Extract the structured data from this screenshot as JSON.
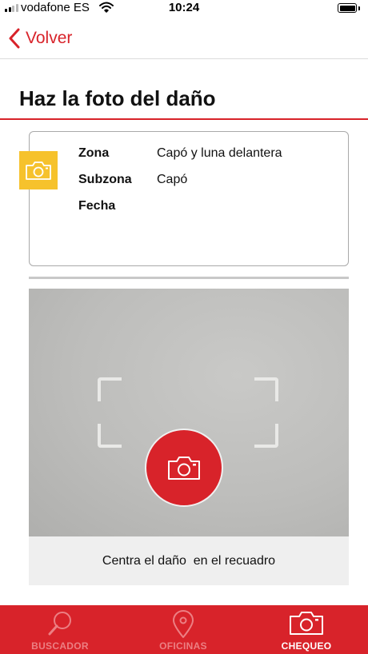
{
  "status_bar": {
    "carrier": "vodafone ES",
    "time": "10:24"
  },
  "nav": {
    "back_label": "Volver"
  },
  "page": {
    "title": "Haz la foto del daño"
  },
  "info": {
    "rows": [
      {
        "key": "Zona",
        "value": "Capó y luna delantera"
      },
      {
        "key": "Subzona",
        "value": "Capó"
      },
      {
        "key": "Fecha",
        "value": ""
      }
    ]
  },
  "camera": {
    "hint": "Centra el daño  en el recuadro"
  },
  "tabbar": {
    "tabs": [
      {
        "label": "BUSCADOR",
        "icon": "search-icon",
        "active": false
      },
      {
        "label": "OFICINAS",
        "icon": "location-pin-icon",
        "active": false
      },
      {
        "label": "CHEQUEO",
        "icon": "camera-icon",
        "active": true
      }
    ]
  },
  "colors": {
    "accent": "#d8232a",
    "tag": "#f6c22c"
  }
}
